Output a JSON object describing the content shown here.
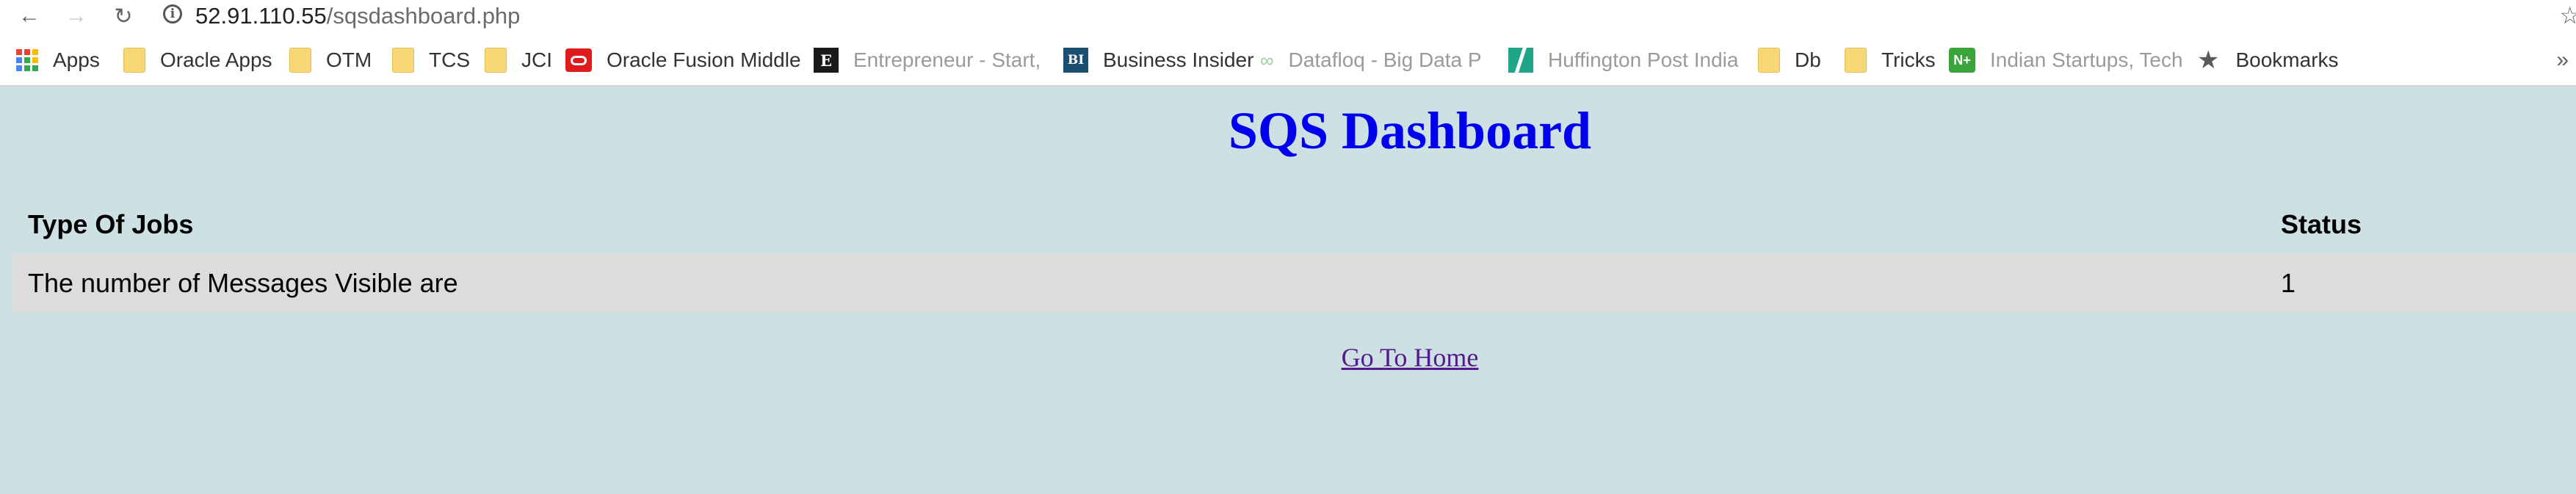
{
  "browser": {
    "url_host": "52.91.110.55",
    "url_path": "/sqsdashboard.php",
    "bookmarks": [
      {
        "label": "Apps",
        "icon": "apps-grid-icon"
      },
      {
        "label": "Oracle Apps",
        "icon": "folder-icon"
      },
      {
        "label": "OTM",
        "icon": "folder-icon"
      },
      {
        "label": "TCS",
        "icon": "folder-icon"
      },
      {
        "label": "JCI",
        "icon": "folder-icon"
      },
      {
        "label": "Oracle Fusion Middle",
        "icon": "oracle-icon"
      },
      {
        "label": "Entrepreneur - Start,",
        "icon": "entrepreneur-icon"
      },
      {
        "label": "Business Insider",
        "icon": "business-insider-icon"
      },
      {
        "label": "Datafloq - Big Data P",
        "icon": "datafloq-icon"
      },
      {
        "label": "Huffington Post India",
        "icon": "huffington-post-icon"
      },
      {
        "label": "Db",
        "icon": "folder-icon"
      },
      {
        "label": "Tricks",
        "icon": "folder-icon"
      },
      {
        "label": "Indian Startups, Tech",
        "icon": "n-plus-icon"
      },
      {
        "label": "Bookmarks",
        "icon": "star-icon"
      }
    ],
    "icons": {
      "entrepreneur_letter": "E",
      "business_insider_letters": "BI",
      "n_plus_letters": "N+"
    }
  },
  "page": {
    "title": "SQS Dashboard",
    "table": {
      "headers": [
        "Type Of Jobs",
        "Status"
      ],
      "rows": [
        [
          "The number of Messages Visible are",
          "1"
        ]
      ]
    },
    "home_link": "Go To Home"
  },
  "colors": {
    "page_background": "#cde0e3",
    "title": "#0000ee",
    "row_highlight": "#dcdcdc",
    "visited_link": "#551a8b"
  }
}
